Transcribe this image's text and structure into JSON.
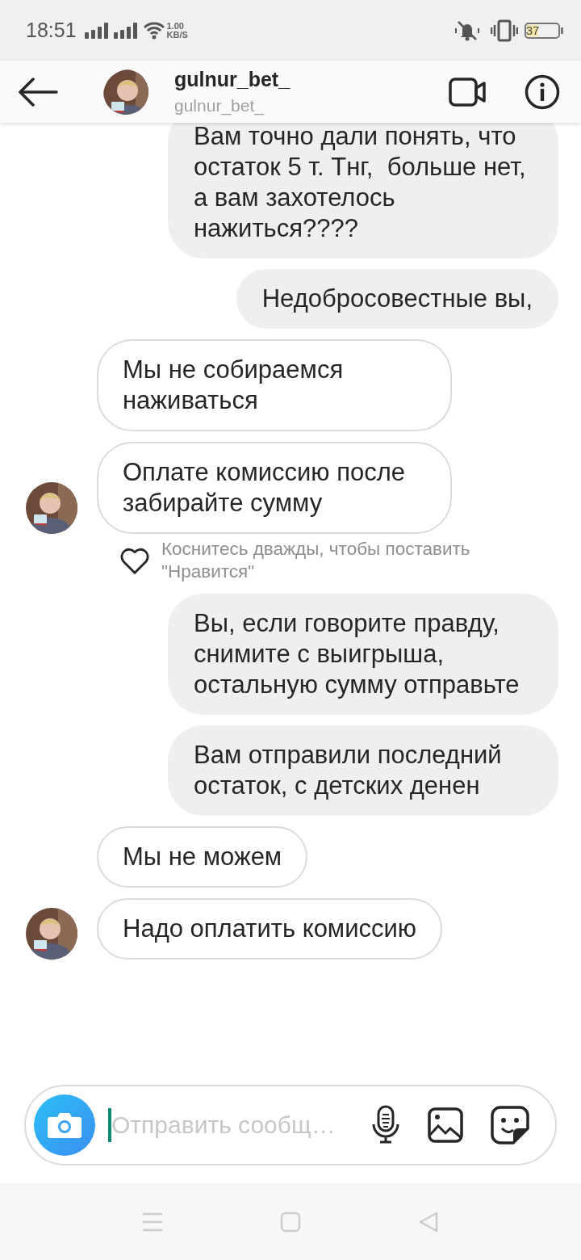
{
  "status_bar": {
    "time": "18:51",
    "speed_value": "1.00",
    "speed_unit": "KB/S",
    "battery": "37"
  },
  "header": {
    "name": "gulnur_bet_",
    "username": "gulnur_bet_"
  },
  "messages": [
    {
      "kind": "sent",
      "text": "Вам точно дали понять, что остаток 5 т. Тнг,  больше нет, а вам захотелось нажиться????"
    },
    {
      "kind": "sent",
      "text": "Недобросовестные вы,"
    },
    {
      "kind": "received",
      "text": "Мы не собираемся наживаться",
      "avatar": false
    },
    {
      "kind": "received",
      "text": "Оплате комиссию после забирайте сумму",
      "avatar": true,
      "like_hint": "Коснитесь дважды, чтобы поставить \"Нравится\""
    },
    {
      "kind": "sent",
      "text": "Вы, если говорите правду, снимите с выигрыша, остальную сумму отправьте"
    },
    {
      "kind": "sent",
      "text": "Вам отправили последний остаток, с детских денен"
    },
    {
      "kind": "received",
      "text": "Мы не можем",
      "avatar": false
    },
    {
      "kind": "received",
      "text": "Надо оплатить комиссию",
      "avatar": true
    }
  ],
  "composer": {
    "placeholder": "Отправить сообщ…"
  }
}
